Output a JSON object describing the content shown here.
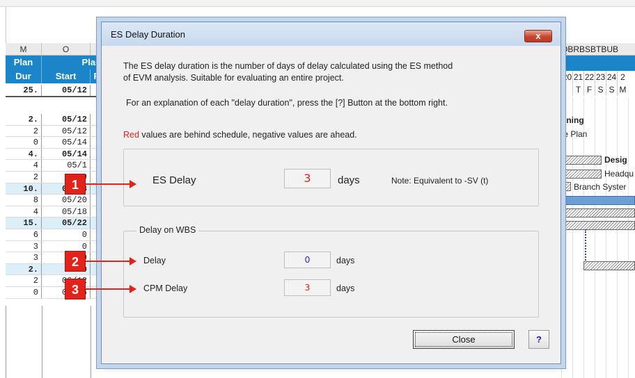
{
  "spreadsheet": {
    "col_letters": [
      "M",
      "O"
    ],
    "head_row1": [
      "Plan",
      "Plan"
    ],
    "head_row2": [
      "Dur",
      "Start"
    ],
    "head_row2_trunc": "F",
    "total_row": {
      "dur": "25.",
      "start": "05/12"
    },
    "rows": [
      {
        "dur": "2.",
        "start": "05/12",
        "style": "bold"
      },
      {
        "dur": "2",
        "start": "05/12",
        "style": "normal"
      },
      {
        "dur": "0",
        "start": "05/14",
        "style": "normal"
      },
      {
        "dur": "4.",
        "start": "05/14",
        "style": "bold"
      },
      {
        "dur": "4",
        "start": "05/1",
        "style": "normal"
      },
      {
        "dur": "2",
        "start": "0",
        "style": "normal"
      },
      {
        "dur": "10.",
        "start": "05/18",
        "style": "summary"
      },
      {
        "dur": "8",
        "start": "05/20",
        "style": "normal"
      },
      {
        "dur": "4",
        "start": "05/18",
        "style": "normal"
      },
      {
        "dur": "15.",
        "start": "05/22",
        "style": "summary"
      },
      {
        "dur": "6",
        "start": "0",
        "style": "normal"
      },
      {
        "dur": "3",
        "start": "0",
        "style": "normal"
      },
      {
        "dur": "3",
        "start": "0",
        "style": "normal"
      },
      {
        "dur": "2.",
        "start": "0",
        "style": "summary"
      },
      {
        "dur": "2",
        "start": "06/12",
        "style": "normal"
      },
      {
        "dur": "0",
        "start": "06/16",
        "style": "normal"
      }
    ],
    "gantt_col_letters": "QBRBSBTBUB",
    "gantt_days": [
      "20",
      "21",
      "22",
      "23",
      "24",
      "2"
    ],
    "gantt_dow": [
      "",
      "T",
      "F",
      "S",
      "S",
      "M"
    ],
    "gantt_texts": {
      "planning": "nning",
      "plan": "te Plan",
      "design": "Desig",
      "headquarters": "Headqu",
      "branch": "Branch Syster"
    }
  },
  "dialog": {
    "title": "ES Delay Duration",
    "close_x": "x",
    "description_line1": "The ES delay duration is the number of days of delay calculated using the ES method",
    "description_line2": "of EVM analysis. Suitable for evaluating an entire project.",
    "explanation": "For an explanation of each \"delay duration\", press the [?] Button at the bottom right.",
    "legend_red": "Red",
    "legend_rest": " values are behind schedule, negative values are ahead.",
    "es_delay": {
      "label": "ES Delay",
      "value": "3",
      "unit": "days",
      "note": "Note: Equivalent to -SV (t)"
    },
    "wbs_group": {
      "title": "Delay on WBS",
      "delay_label": "Delay",
      "delay_value": "0",
      "delay_unit": "days",
      "cpm_label": "CPM Delay",
      "cpm_value": "3",
      "cpm_unit": "days"
    },
    "close_button": "Close",
    "help_button": "?"
  },
  "callouts": [
    "1",
    "2",
    "3"
  ],
  "colors": {
    "accent_red": "#e3231a",
    "header_blue": "#1a86c9",
    "delay_blue": "#2a2ad8",
    "delay_red": "#e0241b"
  }
}
